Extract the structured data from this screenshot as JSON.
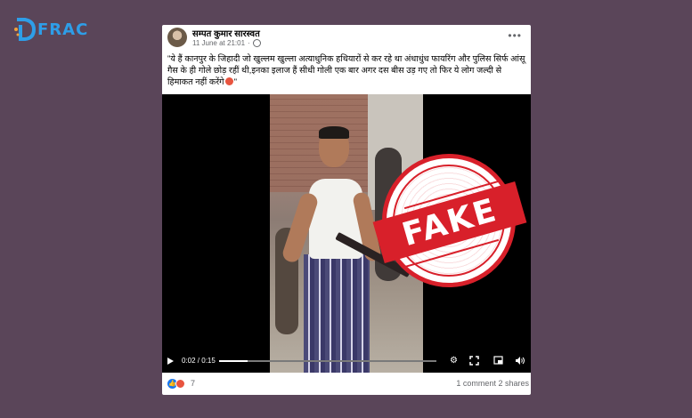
{
  "logo": {
    "text": "FRAC"
  },
  "post": {
    "author": "सम्पत कुमार सारस्वत",
    "timestamp": "11 June at 21:01",
    "caption": "\"ये हैं कानपुर के जिहादी जो खुल्लम खुल्ला अत्याधुनिक हथियारों से कर रहे था अंधाधुंध फायरिंग और पुलिस सिर्फ आंसू गैस के ही गोले छोड़ रहीं थी,इनका इलाज हैं सीधी गोली एक बार अगर दस बीस उड़ गए तो फिर ये लोग जल्दी से हिमाकत नहीं करेंगे",
    "caption_end": "\""
  },
  "video": {
    "time_display": "0:02 / 0:15",
    "progress": 0.13
  },
  "stamp": {
    "text": "FAKE",
    "color": "#d8202a"
  },
  "footer": {
    "reaction_count": "7",
    "comments": "1 comment",
    "shares": "2 shares"
  },
  "icons": [
    "globe-icon",
    "more-options-icon",
    "play-icon",
    "settings-icon",
    "fullscreen-icon",
    "pip-icon",
    "volume-icon",
    "like-reaction-icon",
    "angry-reaction-icon"
  ],
  "colors": {
    "background": "#5a4559",
    "brand": "#2e9ee8",
    "like": "#1877f2",
    "angry": "#e8543f"
  }
}
